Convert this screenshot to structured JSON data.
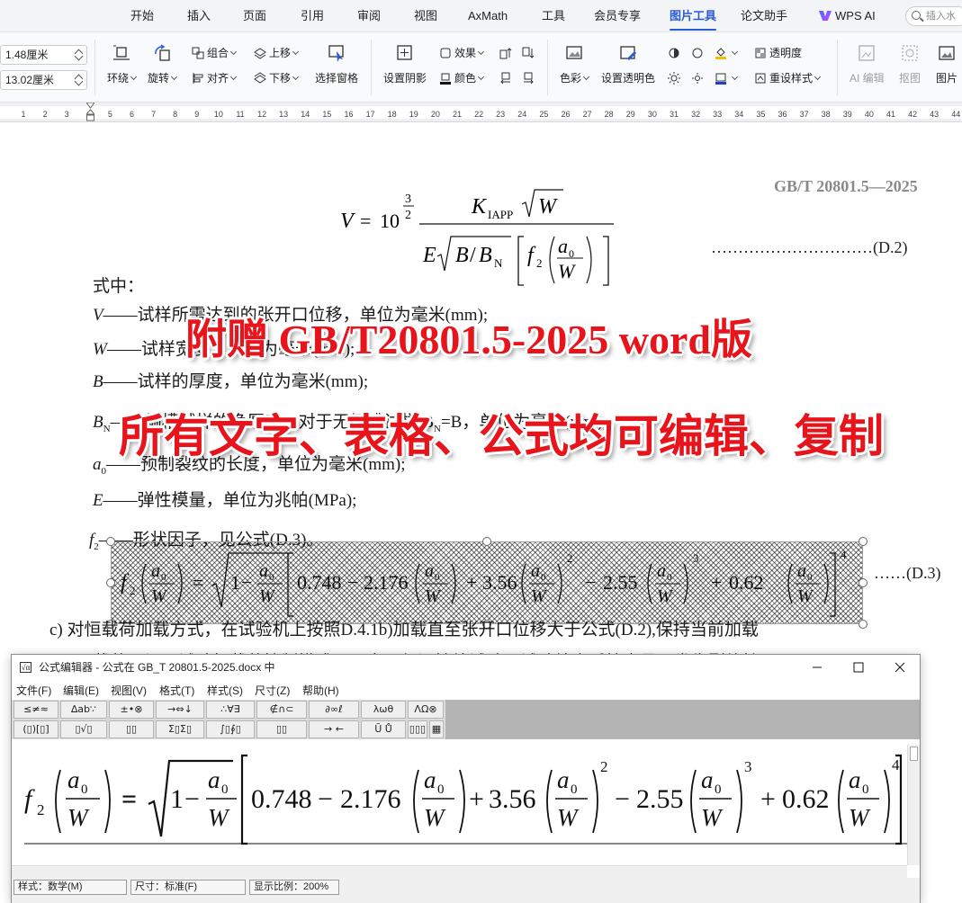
{
  "tabs": [
    "开始",
    "插入",
    "页面",
    "引用",
    "审阅",
    "视图",
    "AxMath",
    "工具",
    "会员专享",
    "图片工具",
    "论文助手",
    "WPS AI"
  ],
  "active_tab": "图片工具",
  "search": {
    "placeholder": "插入水"
  },
  "toolbar": {
    "width_value": "1.48厘米",
    "height_value": "13.02厘米",
    "wrap": "环绕",
    "rotate": "旋转",
    "group": "组合",
    "align": "对齐",
    "bring_forward": "上移",
    "send_backward": "下移",
    "selection_pane": "选择窗格",
    "shadow": "设置阴影",
    "effects": "效果",
    "color": "颜色",
    "recolor": "色彩",
    "set_transparent_color": "设置透明色",
    "transparency": "透明度",
    "reset_style": "重设样式",
    "ai_edit": "AI 编辑",
    "cutout": "抠图",
    "picture_more": "图片"
  },
  "ruler": {
    "ticks": [
      "1",
      "2",
      "3",
      "4",
      "5",
      "6",
      "7",
      "8",
      "9",
      "10",
      "11",
      "12",
      "13",
      "14",
      "15",
      "16",
      "17",
      "18",
      "19",
      "20",
      "21",
      "22",
      "23",
      "24",
      "25",
      "26",
      "27",
      "28",
      "29",
      "30",
      "31",
      "32",
      "33",
      "34",
      "35",
      "36",
      "37",
      "38",
      "39",
      "40",
      "41",
      "42",
      "43",
      "44"
    ]
  },
  "document": {
    "standard_code": "GB/T 20801.5—2025",
    "eq_d2_number": "…………………………(D.2)",
    "eq_d3_number": "……(D.3)",
    "shizhong": "式中：",
    "defs": [
      {
        "sym": "V",
        "text": "——试样所需达到的张开口位移，单位为毫米(mm);"
      },
      {
        "sym": "W",
        "text": "——试样宽度，单位为毫米(mm);"
      },
      {
        "sym": "B",
        "text": "——试样的厚度，单位为毫米(mm);"
      },
      {
        "sym": "B",
        "sub": "N",
        "text": "——侧槽试样的净厚度，对于无侧槽试样 B",
        "tail": "=B，单位为毫米(mm);"
      },
      {
        "sym": "a",
        "sub": "0",
        "text": "——预制裂纹的长度，单位为毫米(mm);"
      },
      {
        "sym": "E",
        "text": "——弹性模量，单位为兆帕(MPa);"
      },
      {
        "sym": "f",
        "sub": "2",
        "text": "——形状因子，见公式(D.3)。"
      }
    ],
    "item_c": "c) 对恒载荷加载方式，在试验机上按照D.4.1b)加载直至张开口位移大于公式(D.2),保持当前加载",
    "item_c_cont": "载荷，切于试验机载荷控制模式下同意可保证持续试验，试验结束后检查是否发生裂纹扩展，"
  },
  "promo": {
    "line1": "附赠  GB/T20801.5-2025 word版",
    "line2": "所有文字、表格、公式均可编辑、复制"
  },
  "equation_d2": {
    "lhs": "V",
    "eq": "=",
    "base": "10",
    "exp_num": "3",
    "exp_den": "2",
    "num_k": "K",
    "num_k_sub": "IAPP",
    "num_w": "W",
    "den_e": "E",
    "den_b": "B",
    "den_slash": "/",
    "den_bn": "B",
    "den_bn_sub": "N",
    "den_f": "f",
    "den_f_sub": "2",
    "frac_a": "a",
    "frac_a_sub": "0",
    "frac_w": "W"
  },
  "equation_d3": {
    "f": "f",
    "f_sub": "2",
    "eq": "=",
    "one": "1",
    "minus": "−",
    "c0": "0.748",
    "c1": "2.176",
    "plus": "+",
    "c2": "3.56",
    "c3": "2.55",
    "c4": "0.62",
    "p2": "2",
    "p3": "3",
    "p4": "4",
    "a": "a",
    "a_sub": "0",
    "w": "W"
  },
  "editor": {
    "title": "公式编辑器 - 公式在 GB_T 20801.5-2025.docx 中",
    "menus": [
      "文件(F)",
      "编辑(E)",
      "视图(V)",
      "格式(T)",
      "样式(S)",
      "尺寸(Z)",
      "帮助(H)"
    ],
    "palette_row1": [
      "≤≠≈",
      "∆ab∵",
      "±•⊗",
      "→⇔↓",
      "∴∀∃",
      "∉∩⊂",
      "∂∞ℓ",
      "λωθ",
      "ΛΩ⊗"
    ],
    "palette_row2": [
      "(▯)[▯]",
      "▯√▯",
      "▯▯",
      "Σ▯Σ▯",
      "∫▯∮▯",
      "▯▯",
      "→ ←",
      "Ū Ů",
      "▯▯▯",
      "▦"
    ],
    "status": {
      "style": "样式：数学(M)",
      "size": "尺寸：标准(F)",
      "zoom": "显示比例：200%"
    }
  },
  "colors": {
    "accent": "#2a5bd7",
    "promo_red": "#e8141c"
  }
}
